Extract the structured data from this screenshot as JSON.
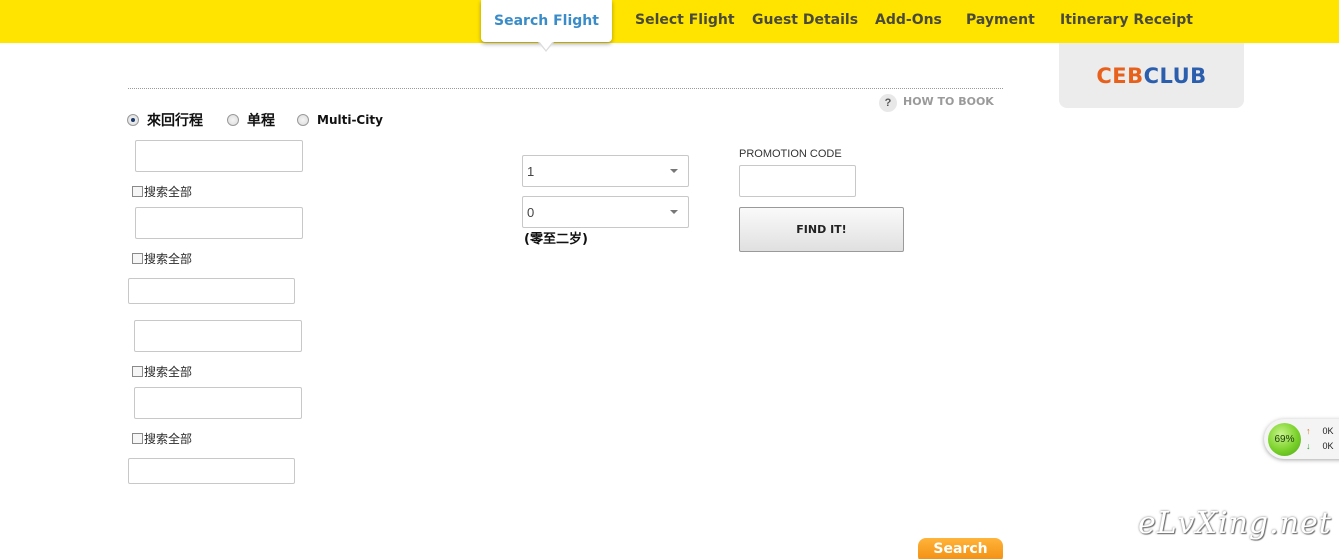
{
  "nav": {
    "tabs": [
      {
        "label": "Search Flight",
        "active": true
      },
      {
        "label": "Select Flight"
      },
      {
        "label": "Guest Details"
      },
      {
        "label": "Add-Ons"
      },
      {
        "label": "Payment"
      },
      {
        "label": "Itinerary Receipt"
      }
    ],
    "active_color": "#3a8cc8",
    "bar_color": "#ffe400"
  },
  "club": {
    "part1": "CEB",
    "part2": "CLUB"
  },
  "how_to_book": {
    "icon_text": "?",
    "label": "HOW TO BOOK"
  },
  "trip_type": {
    "options": [
      {
        "label": "來回行程",
        "checked": true
      },
      {
        "label": "单程",
        "checked": false
      },
      {
        "label": "Multi-City",
        "checked": false
      }
    ]
  },
  "search_all_label": "搜索全部",
  "passengers": {
    "adults_value": "1",
    "children_value": "0",
    "children_note": "(零至二岁)"
  },
  "promotion": {
    "label": "PROMOTION CODE",
    "value": ""
  },
  "find_button": "FIND IT!",
  "search_button": "Search",
  "speed_meter": {
    "percent": "69%",
    "up": "0K",
    "down": "0K"
  },
  "watermark": "eLvXing.net"
}
